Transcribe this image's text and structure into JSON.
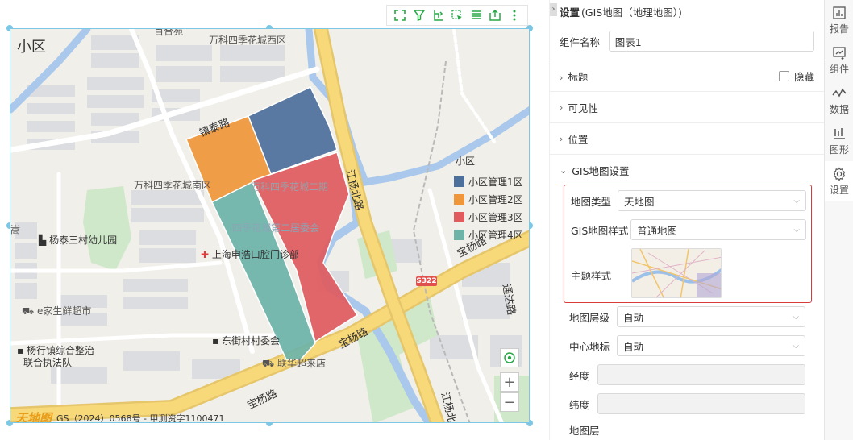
{
  "map": {
    "title": "小区",
    "place_labels": [
      {
        "text": "百合苑",
        "id": "p1"
      },
      {
        "text": "万科四季花城西区",
        "id": "p2"
      },
      {
        "text": "万科四季花城南区",
        "id": "p3"
      },
      {
        "text": "万科四季花城二期",
        "id": "p4"
      },
      {
        "text": "四季花城第二居委会",
        "id": "p5"
      },
      {
        "text": "杨泰三村幼儿园",
        "id": "p6"
      },
      {
        "text": "上海申浩口腔门诊部",
        "id": "p7"
      },
      {
        "text": "e家生鲜超市",
        "id": "p8"
      },
      {
        "text": "杨行镇综合整治",
        "id": "p9"
      },
      {
        "text": "联合执法队",
        "id": "p10"
      },
      {
        "text": "东街村村委会",
        "id": "p11"
      },
      {
        "text": "联华超来店",
        "id": "p12"
      },
      {
        "text": "嵩",
        "id": "p13"
      }
    ],
    "road_labels": {
      "r1": "镇泰路",
      "r2": "江杨北路",
      "r3": "宝杨路",
      "r4": "宝杨路",
      "r5": "宝杨路",
      "r6": "通达路",
      "r7": "江杨北路",
      "shield": "S322"
    },
    "copyright_logo": "天地图",
    "copyright_text": "GS（2024）0568号 - 甲测资字1100471"
  },
  "legend": {
    "title": "小区",
    "items": [
      {
        "label": "小区管理1区",
        "color": "#4c6f9c"
      },
      {
        "label": "小区管理2区",
        "color": "#f0963a"
      },
      {
        "label": "小区管理3区",
        "color": "#e05a5e"
      },
      {
        "label": "小区管理4区",
        "color": "#6db3a8"
      }
    ]
  },
  "toolbar": [
    "fullscreen-icon",
    "filter-icon",
    "drill-icon",
    "select-icon",
    "list-icon",
    "export-icon",
    "more-icon"
  ],
  "panel": {
    "header_main": "设置",
    "header_sub": "(GIS地图（地理地图）)",
    "component_name_label": "组件名称",
    "component_name_value": "图表1",
    "sections": {
      "title": "标题",
      "hide": "隐藏",
      "visibility": "可见性",
      "position": "位置",
      "gis": "GIS地图设置"
    },
    "map_type_label": "地图类型",
    "map_type_value": "天地图",
    "map_style_label": "GIS地图样式",
    "map_style_value": "普通地图",
    "theme_label": "主题样式",
    "map_level_label": "地图层级",
    "map_level_value": "自动",
    "center_label": "中心地标",
    "center_value": "自动",
    "lng_label": "经度",
    "lat_label": "纬度",
    "layer_label": "地图层"
  },
  "tabs": [
    {
      "label": "报告",
      "icon": "report-icon"
    },
    {
      "label": "组件",
      "icon": "component-icon"
    },
    {
      "label": "数据",
      "icon": "data-icon"
    },
    {
      "label": "图形",
      "icon": "shape-icon"
    },
    {
      "label": "设置",
      "icon": "gear-icon",
      "active": true
    }
  ]
}
